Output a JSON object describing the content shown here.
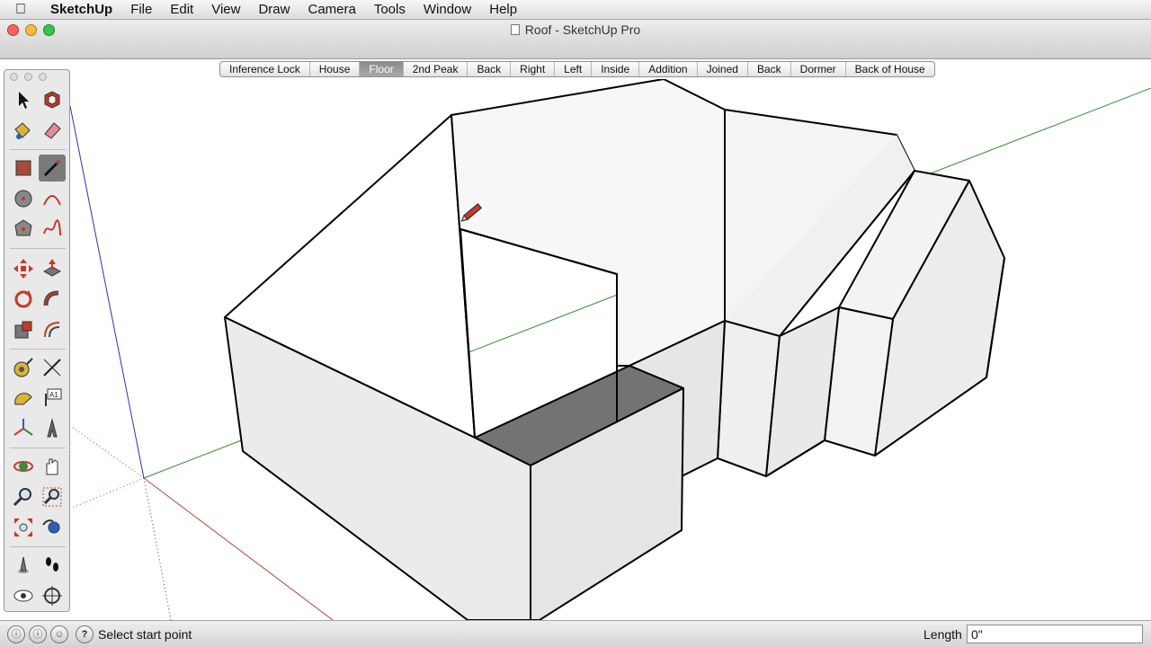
{
  "menubar": {
    "app": "SketchUp",
    "items": [
      "File",
      "Edit",
      "View",
      "Draw",
      "Camera",
      "Tools",
      "Window",
      "Help"
    ]
  },
  "window": {
    "title": "Roof - SketchUp Pro"
  },
  "scenes": [
    {
      "label": "Inference Lock",
      "active": false
    },
    {
      "label": "House",
      "active": false
    },
    {
      "label": "Floor",
      "active": true
    },
    {
      "label": "2nd Peak",
      "active": false
    },
    {
      "label": "Back",
      "active": false
    },
    {
      "label": "Right",
      "active": false
    },
    {
      "label": "Left",
      "active": false
    },
    {
      "label": "Inside",
      "active": false
    },
    {
      "label": "Addition",
      "active": false
    },
    {
      "label": "Joined",
      "active": false
    },
    {
      "label": "Back",
      "active": false
    },
    {
      "label": "Dormer",
      "active": false
    },
    {
      "label": "Back of House",
      "active": false
    }
  ],
  "tools": [
    "select",
    "component",
    "paint-bucket",
    "eraser",
    "rectangle",
    "line",
    "circle",
    "arc",
    "polygon",
    "freehand",
    "move",
    "push-pull",
    "rotate",
    "follow-me",
    "scale",
    "offset",
    "tape-measure",
    "dimension",
    "protractor",
    "text",
    "axes",
    "3d-text",
    "orbit",
    "pan",
    "zoom",
    "zoom-window",
    "zoom-extents",
    "previous-view",
    "position-camera",
    "walk",
    "look-around",
    "section-plane"
  ],
  "active_tool": "line",
  "status": {
    "text": "Select start point",
    "length_label": "Length",
    "length_value": "0\""
  },
  "colors": {
    "axis_red": "#b04040",
    "axis_green": "#3a8a3a",
    "axis_blue": "#3030b0",
    "face_front": "#ebebeb",
    "face_dark": "#737373",
    "face_inner": "#f6f6f6"
  }
}
